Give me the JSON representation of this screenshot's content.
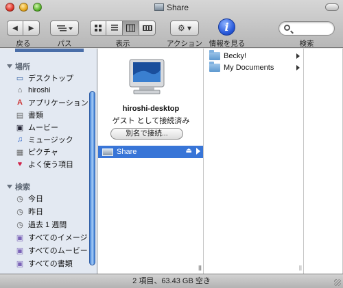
{
  "window": {
    "title": "Share"
  },
  "toolbar": {
    "back_label": "戻る",
    "path_label": "パス",
    "view_label": "表示",
    "action_label": "アクション",
    "info_label": "情報を見る",
    "search_label": "検索",
    "back_glyph": "◀",
    "forward_glyph": "▶",
    "action_glyph": "⚙ ▾",
    "info_glyph": "i",
    "view_modes": [
      "icon",
      "list",
      "column",
      "coverflow"
    ],
    "active_view": "column"
  },
  "sidebar": {
    "places_header": "場所",
    "places": [
      {
        "label": "デスクトップ",
        "icon": "desktop-icon",
        "glyph": "▭"
      },
      {
        "label": "hiroshi",
        "icon": "home-icon",
        "glyph": "⌂"
      },
      {
        "label": "アプリケーション",
        "icon": "applications-icon",
        "glyph": "A"
      },
      {
        "label": "書類",
        "icon": "documents-icon",
        "glyph": "▤"
      },
      {
        "label": "ムービー",
        "icon": "movies-icon",
        "glyph": "▣"
      },
      {
        "label": "ミュージック",
        "icon": "music-icon",
        "glyph": "♫"
      },
      {
        "label": "ピクチャ",
        "icon": "pictures-icon",
        "glyph": "▦"
      },
      {
        "label": "よく使う項目",
        "icon": "favorites-heart-icon",
        "glyph": "♥"
      }
    ],
    "search_header": "検索",
    "searches": [
      {
        "label": "今日",
        "icon": "clock-icon",
        "glyph": "◷"
      },
      {
        "label": "昨日",
        "icon": "clock-icon",
        "glyph": "◷"
      },
      {
        "label": "過去 1 週間",
        "icon": "clock-icon",
        "glyph": "◷"
      },
      {
        "label": "すべてのイメージ",
        "icon": "smart-folder-icon",
        "glyph": "▣"
      },
      {
        "label": "すべてのムービー",
        "icon": "smart-folder-icon",
        "glyph": "▣"
      },
      {
        "label": "すべての書類",
        "icon": "smart-folder-icon",
        "glyph": "▣"
      }
    ]
  },
  "column1": {
    "host_name": "hiroshi-desktop",
    "guest_status": "ゲスト として接続済み",
    "connect_as_button": "別名で接続...",
    "share_item": "Share",
    "eject_glyph": "⏏"
  },
  "column2": {
    "items": [
      "Becky!",
      "My Documents"
    ]
  },
  "status_bar": {
    "text": "2 項目、63.43 GB 空き"
  },
  "colors": {
    "selection": "#3875d7",
    "sidebar_bg": "#e3e9f2",
    "info_blue": "#2657d9"
  }
}
